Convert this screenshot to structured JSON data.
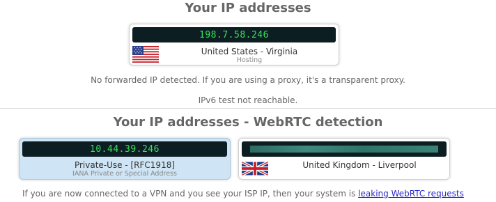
{
  "section1": {
    "heading": "Your IP addresses",
    "card": {
      "ip": "198.7.58.246",
      "location": "United States - Virginia",
      "type": "Hosting",
      "flag_icon": "us-flag-icon"
    },
    "forward_message": "No forwarded IP detected. If you are using a proxy, it's a transparent proxy.",
    "ipv6_message": "IPv6 test not reachable."
  },
  "section2": {
    "heading": "Your IP addresses - WebRTC detection",
    "private_card": {
      "ip": "10.44.39.246",
      "label": "Private-Use - [RFC1918]",
      "sublabel": "IANA Private or Special Address"
    },
    "public_card": {
      "location": "United Kingdom - Liverpool",
      "flag_icon": "uk-flag-icon"
    },
    "warning_text": "If you are now connected to a VPN and you see your ISP IP, then your system is",
    "warning_link": "leaking WebRTC requests"
  },
  "colors": {
    "ip_text": "#39e05b",
    "ip_background": "#0d1e22",
    "private_card_bg": "#cfe4f4",
    "link": "#2a2acb"
  }
}
